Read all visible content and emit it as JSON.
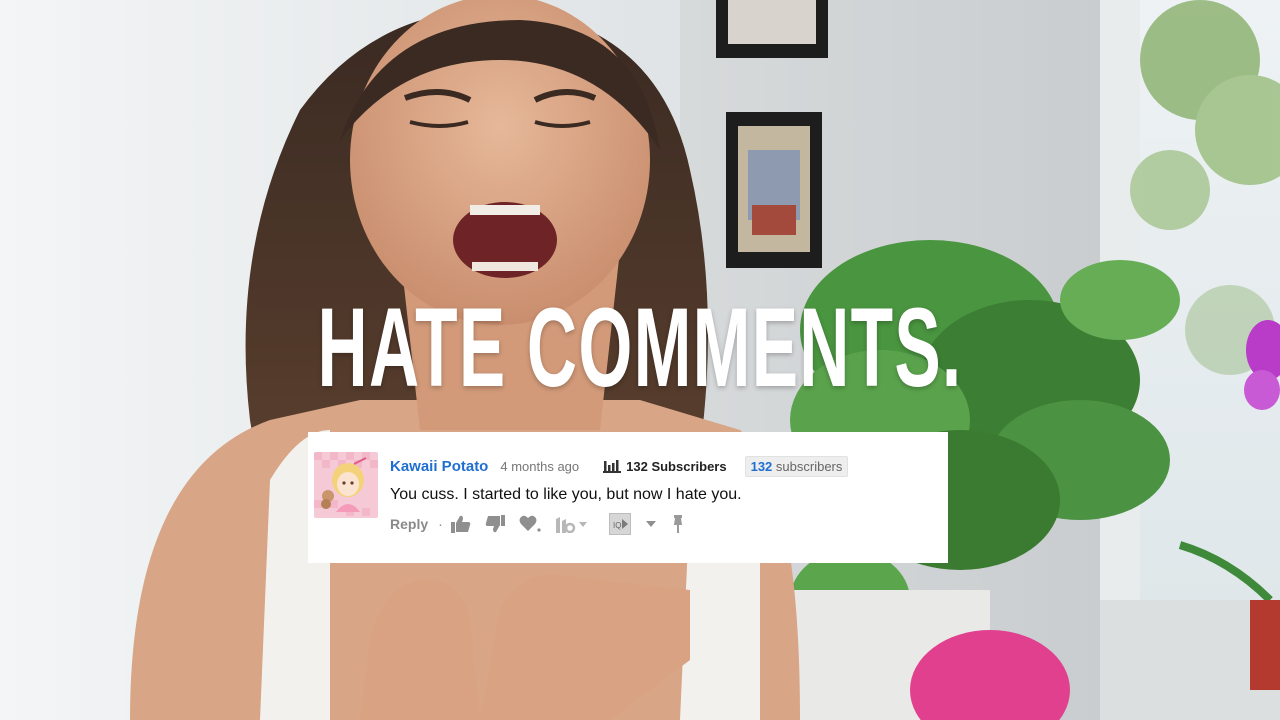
{
  "headline": "HATE COMMENTS.",
  "comment": {
    "author": "Kawaii Potato",
    "time": "4 months ago",
    "subscribers_a": "132 Subscribers",
    "subscribers_b_count": "132",
    "subscribers_b_label": "subscribers",
    "text": "You cuss. I started to like you, but now I hate you.",
    "reply_label": "Reply",
    "reply_separator": "·"
  },
  "icons": [
    "thumbs-up-icon",
    "thumbs-down-icon",
    "heart-icon",
    "tubebuddy-icon",
    "caret-down-icon",
    "video-icon",
    "pin-icon"
  ],
  "colors": {
    "headline": "#ffffff",
    "author": "#1f6fd1",
    "card_background": "#ffffff"
  }
}
